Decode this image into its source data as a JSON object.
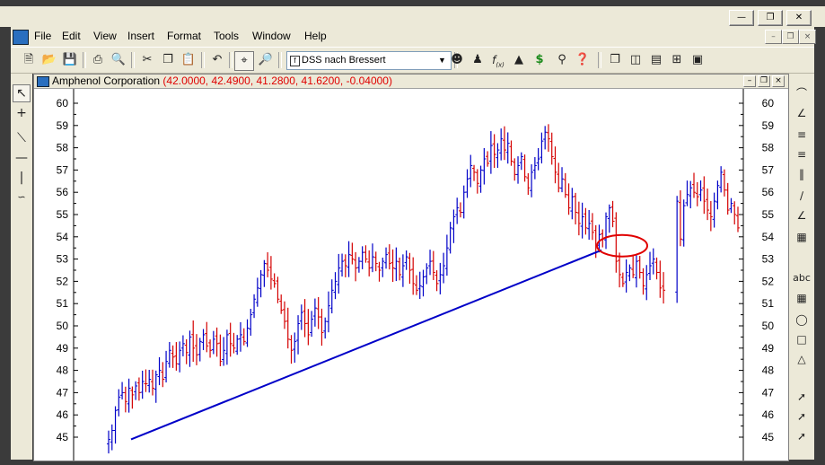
{
  "window": {
    "min_icon": "minimize-icon",
    "max_icon": "restore-icon",
    "close_icon": "close-icon"
  },
  "menu": {
    "items": [
      "File",
      "Edit",
      "View",
      "Insert",
      "Format",
      "Tools",
      "Window",
      "Help"
    ]
  },
  "toolbar": {
    "study_combo_value": "DSS nach Bressert",
    "study_combo_icon": "f"
  },
  "chart_window": {
    "title": "Amphenol Corporation",
    "ohlc": "(42.0000, 42.4900, 41.2800, 41.6200, -0.04000)"
  },
  "colors": {
    "up_bar": "#0000c8",
    "down_bar": "#d40000",
    "trendline": "#0000c8",
    "highlight_circle": "#e00000"
  },
  "chart_data": {
    "type": "ohlc-bar",
    "title": "Amphenol Corporation",
    "y_ticks": [
      45,
      46,
      47,
      48,
      49,
      50,
      51,
      52,
      53,
      54,
      55,
      56,
      57,
      58,
      59,
      60
    ],
    "ylim": [
      44.5,
      60.5
    ],
    "grid": false,
    "series": [
      {
        "name": "Amphenol Corporation",
        "closes": [
          44.9,
          45.3,
          46.2,
          46.8,
          47.0,
          46.6,
          47.2,
          46.9,
          47.3,
          47.0,
          47.5,
          47.4,
          47.6,
          47.2,
          47.8,
          48.0,
          47.6,
          48.4,
          48.9,
          48.6,
          48.3,
          48.9,
          49.2,
          48.8,
          49.5,
          49.0,
          48.7,
          49.3,
          49.6,
          49.1,
          48.9,
          49.4,
          49.2,
          48.4,
          48.9,
          49.6,
          49.2,
          49.0,
          49.4,
          49.6,
          49.3,
          49.9,
          50.5,
          51.2,
          51.7,
          52.3,
          52.8,
          52.5,
          52.1,
          51.9,
          51.2,
          50.7,
          50.2,
          49.4,
          48.9,
          49.3,
          50.1,
          50.6,
          50.1,
          49.6,
          50.3,
          50.8,
          50.4,
          49.7,
          50.2,
          50.9,
          51.6,
          52.0,
          52.6,
          52.9,
          52.7,
          53.2,
          53.0,
          52.6,
          52.9,
          53.3,
          53.0,
          52.6,
          53.1,
          52.8,
          52.5,
          52.9,
          53.2,
          52.8,
          52.6,
          52.9,
          52.3,
          52.7,
          53.1,
          52.5,
          51.9,
          51.6,
          51.8,
          52.2,
          52.6,
          52.9,
          52.4,
          51.9,
          52.3,
          52.7,
          53.5,
          54.4,
          54.9,
          55.3,
          55.1,
          56.0,
          56.6,
          57.2,
          56.9,
          56.4,
          57.0,
          57.5,
          57.3,
          58.1,
          57.7,
          57.9,
          58.4,
          57.9,
          58.2,
          57.4,
          56.8,
          57.2,
          57.6,
          56.7,
          56.2,
          56.9,
          57.2,
          57.5,
          58.3,
          58.7,
          58.4,
          57.6,
          56.9,
          56.2,
          56.6,
          55.9,
          55.3,
          55.8,
          55.1,
          54.6,
          54.9,
          54.4,
          54.6,
          54.2,
          53.6,
          54.1,
          53.9,
          54.9,
          55.3,
          54.7,
          52.9,
          52.3,
          51.9,
          52.4,
          52.6,
          52.3,
          52.9,
          52.4,
          51.8,
          52.3,
          52.7,
          53.0,
          52.4,
          51.7,
          51.6,
          null,
          null,
          null,
          55.6,
          53.9,
          55.4,
          55.9,
          56.2,
          56.0,
          55.8,
          56.1,
          55.6,
          55.2,
          54.9,
          55.6,
          56.3,
          56.9,
          56.1,
          55.2,
          55.5,
          55.0,
          54.4
        ]
      }
    ],
    "trendline": {
      "from_close_index": 0,
      "from_value": 44.9,
      "to_value": 53.4
    }
  }
}
